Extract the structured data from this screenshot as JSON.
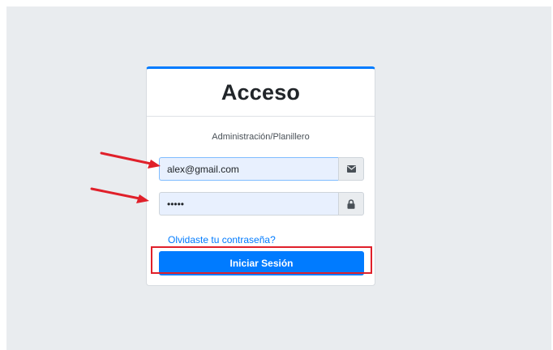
{
  "login": {
    "title": "Acceso",
    "subtitle": "Administración/Planillero",
    "email": {
      "value": "alex@gmail.com",
      "icon": "envelope-icon"
    },
    "password": {
      "value": "•••••",
      "icon": "lock-icon"
    },
    "forgot_link": "Olvidaste tu contraseña?",
    "submit_label": "Iniciar Sesión"
  },
  "colors": {
    "accent": "#007bff",
    "annotation": "#e0202a",
    "background": "#e9ecef",
    "autofill": "#e8f0fe"
  },
  "annotations": {
    "arrows": [
      "email-field",
      "password-field"
    ],
    "highlight": "login-button"
  }
}
